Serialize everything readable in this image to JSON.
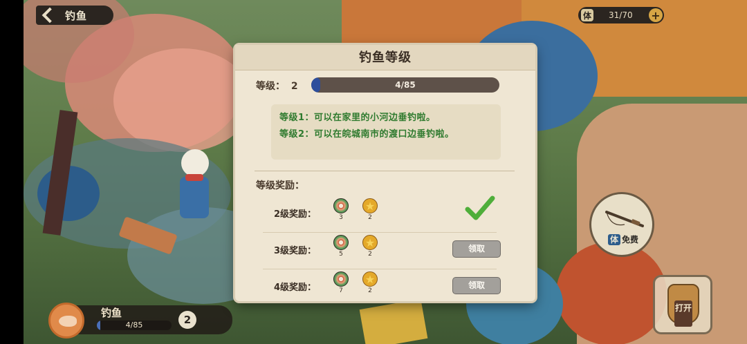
{
  "header": {
    "title": "钓鱼"
  },
  "stamina": {
    "icon_label": "体",
    "value": "31/70",
    "plus": "+"
  },
  "rod": {
    "icon_label": "体",
    "label": "免费"
  },
  "bag": {
    "label": "打开"
  },
  "fish_bar": {
    "name": "钓鱼",
    "progress_text": "4/85",
    "progress": 0.047,
    "level": "2"
  },
  "modal": {
    "title": "钓鱼等级",
    "level_label": "等级：",
    "level_value": "2",
    "progress_text": "4/85",
    "progress": 0.047,
    "descriptions": [
      "等级1：可以在家里的小河边垂钓啦。",
      "等级2：可以在皖城南市的渡口边垂钓啦。"
    ],
    "rewards_header": "等级奖励：",
    "rewards": [
      {
        "label": "2级奖励：",
        "items": [
          {
            "icon": "bait-icon",
            "count": "3"
          },
          {
            "icon": "star-coin-icon",
            "count": "2"
          }
        ],
        "status": "claimed"
      },
      {
        "label": "3级奖励：",
        "items": [
          {
            "icon": "bait-icon",
            "count": "5"
          },
          {
            "icon": "star-coin-icon",
            "count": "2"
          }
        ],
        "status": "claim",
        "button": "领取"
      },
      {
        "label": "4级奖励：",
        "items": [
          {
            "icon": "bait-icon",
            "count": "7"
          },
          {
            "icon": "star-coin-icon",
            "count": "2"
          }
        ],
        "status": "claim",
        "button": "领取"
      }
    ]
  },
  "colors": {
    "progress_blue": "#2d4e9c",
    "desc_green": "#2e7a2e",
    "check_green": "#4fae3a"
  }
}
